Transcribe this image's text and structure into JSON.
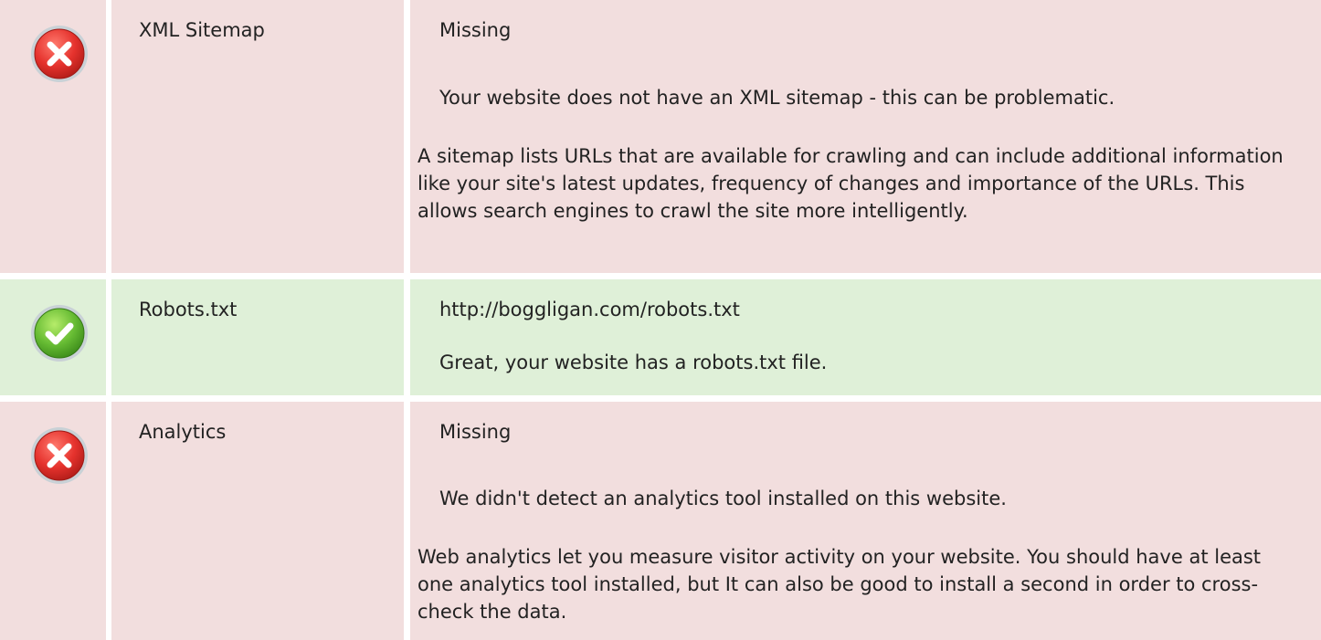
{
  "colors": {
    "fail_background": "#f2dede",
    "pass_background": "#dff0d8",
    "fail_icon": "#e5322d",
    "pass_icon": "#66bb33"
  },
  "checks": [
    {
      "status": "fail",
      "icon": "error-cross-icon",
      "name": "XML Sitemap",
      "value": "Missing",
      "message": "Your website does not have an XML sitemap - this can be problematic.",
      "advice": "A sitemap lists URLs that are available for crawling and can include additional information like your site's latest updates, frequency of changes and importance of the URLs. This allows search engines to crawl the site more intelligently."
    },
    {
      "status": "pass",
      "icon": "success-check-icon",
      "name": "Robots.txt",
      "value": "http://boggligan.com/robots.txt",
      "message": "Great, your website has a robots.txt file."
    },
    {
      "status": "fail",
      "icon": "error-cross-icon",
      "name": "Analytics",
      "value": "Missing",
      "message": "We didn't detect an analytics tool installed on this website.",
      "advice": "Web analytics let you measure visitor activity on your website. You should have at least one analytics tool installed, but It can also be good to install a second in order to cross-check the data."
    }
  ]
}
